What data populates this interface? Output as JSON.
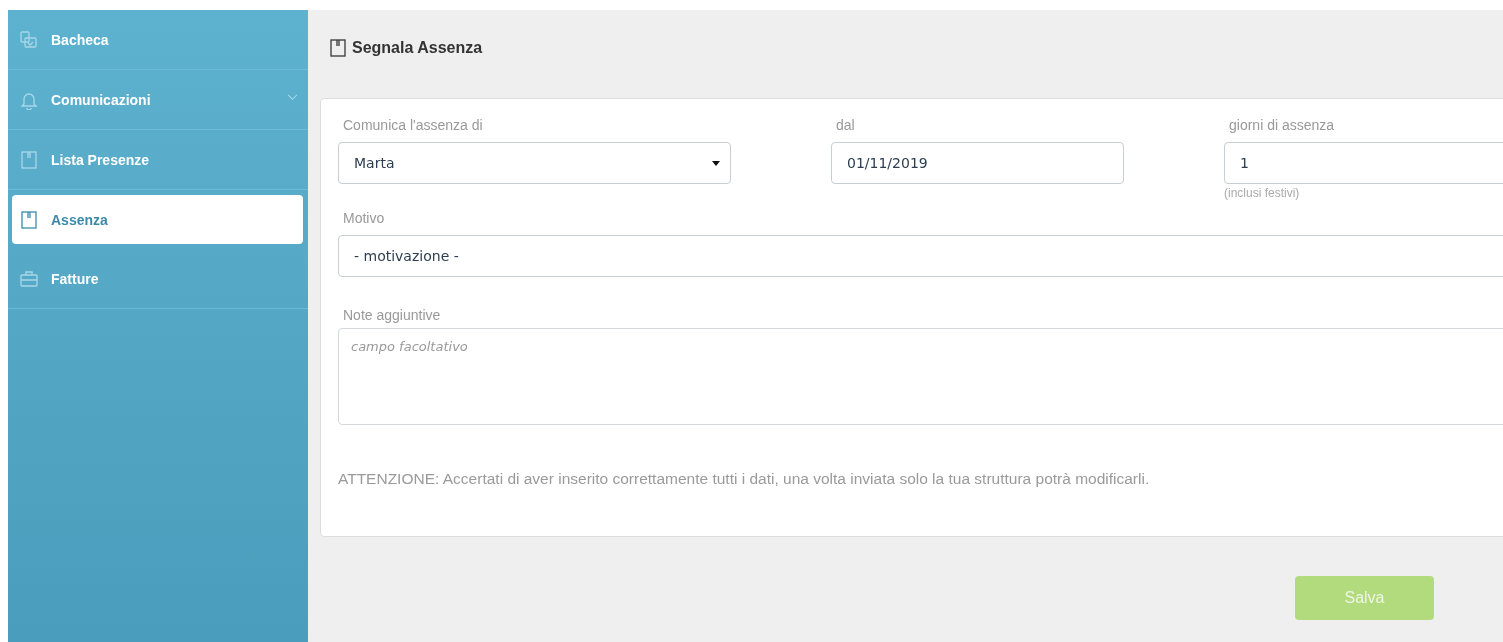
{
  "sidebar": {
    "items": [
      {
        "label": "Bacheca",
        "kind": "board",
        "selected": false
      },
      {
        "label": "Comunicazioni",
        "kind": "bell",
        "selected": false,
        "expanded": false
      },
      {
        "label": "Lista Presenze",
        "kind": "book",
        "selected": false
      },
      {
        "label": "Assenza",
        "kind": "book",
        "selected": true
      },
      {
        "label": "Fatture",
        "kind": "briefcase",
        "selected": false
      }
    ]
  },
  "page": {
    "title": "Segnala Assenza"
  },
  "form": {
    "person": {
      "label": "Comunica l'assenza di",
      "value": "Marta"
    },
    "from": {
      "label": "dal",
      "value": "01/11/2019"
    },
    "days": {
      "label": "giorni di assenza",
      "value": "1",
      "hint": "(inclusi festivi)"
    },
    "reason": {
      "label": "Motivo",
      "value": "- motivazione -"
    },
    "notes": {
      "label": "Note aggiuntive",
      "placeholder": "campo facoltativo"
    },
    "warning": "ATTENZIONE: Accertati di aver inserito correttamente tutti i dati, una volta inviata solo la tua struttura potrà modificarli."
  },
  "save_button": "Salva"
}
